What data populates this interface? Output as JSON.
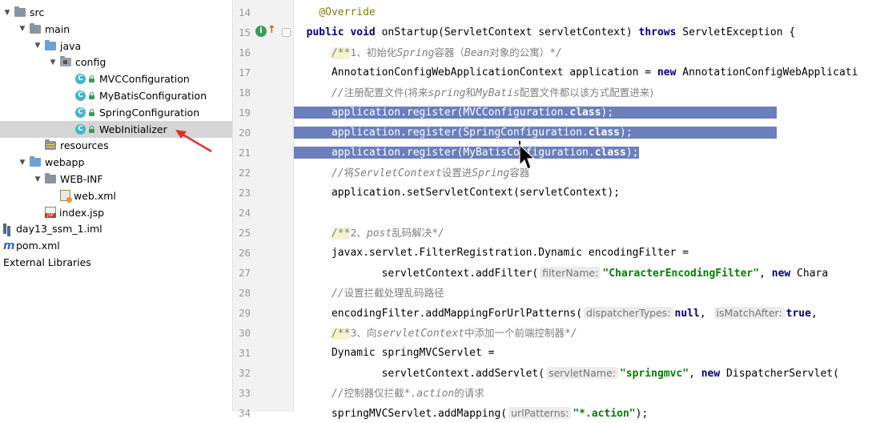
{
  "tree": {
    "items": [
      {
        "label": "src",
        "depth": 0,
        "arrow": "▼",
        "icon": "folder",
        "selected": false
      },
      {
        "label": "main",
        "depth": 1,
        "arrow": "▼",
        "icon": "folder",
        "selected": false
      },
      {
        "label": "java",
        "depth": 2,
        "arrow": "▼",
        "icon": "folder-blue",
        "selected": false
      },
      {
        "label": "config",
        "depth": 3,
        "arrow": "▼",
        "icon": "package",
        "selected": false
      },
      {
        "label": "MVCConfiguration",
        "depth": 4,
        "arrow": "",
        "icon": "class",
        "selected": false
      },
      {
        "label": "MyBatisConfiguration",
        "depth": 4,
        "arrow": "",
        "icon": "class",
        "selected": false
      },
      {
        "label": "SpringConfiguration",
        "depth": 4,
        "arrow": "",
        "icon": "class",
        "selected": false
      },
      {
        "label": "WebInitializer",
        "depth": 4,
        "arrow": "",
        "icon": "class",
        "selected": true
      },
      {
        "label": "resources",
        "depth": 2,
        "arrow": "",
        "icon": "resources",
        "selected": false
      },
      {
        "label": "webapp",
        "depth": 1,
        "arrow": "▼",
        "icon": "folder-web",
        "selected": false
      },
      {
        "label": "WEB-INF",
        "depth": 2,
        "arrow": "▼",
        "icon": "folder",
        "selected": false
      },
      {
        "label": "web.xml",
        "depth": 3,
        "arrow": "",
        "icon": "xml",
        "selected": false
      },
      {
        "label": "index.jsp",
        "depth": 2,
        "arrow": "",
        "icon": "jsp",
        "selected": false
      },
      {
        "label": "day13_ssm_1.iml",
        "depth": 0,
        "arrow": "",
        "icon": "iml",
        "selected": false
      },
      {
        "label": "pom.xml",
        "depth": 0,
        "arrow": "",
        "icon": "maven",
        "selected": false
      },
      {
        "label": "External Libraries",
        "depth": 0,
        "arrow": "",
        "icon": "none",
        "selected": false
      }
    ]
  },
  "editor": {
    "line_numbers": [
      "14",
      "15",
      "16",
      "17",
      "18",
      "19",
      "20",
      "21",
      "22",
      "23",
      "24",
      "25",
      "26",
      "27",
      "28",
      "29",
      "30",
      "31",
      "32",
      "33",
      "34"
    ],
    "lines": {
      "l14": {
        "annotation": "@Override"
      },
      "l15": {
        "kw1": "public",
        "kw2": "void",
        "mid": " onStartup(ServletContext servletContext) ",
        "kw3": "throws",
        "tail": " ServletException {"
      },
      "l16": {
        "open": "/**",
        "text": "1、初始化",
        "it1": "Spring",
        "text2": "容器（",
        "it2": "Bean",
        "text3": "对象的公寓）",
        "close": "*/"
      },
      "l17": {
        "head": "AnnotationConfigWebApplicationContext application = ",
        "kw": "new",
        "tail": " AnnotationConfigWebApplicati"
      },
      "l18": {
        "open": "//",
        "text": "注册配置文件(将来",
        "it1": "spring",
        "text2": "和",
        "it2": "MyBatis",
        "text3": "配置文件都以该方式配置进来)"
      },
      "l19": {
        "head": "application.register(MVCConfiguration.",
        "kw": "class",
        "tail": ");"
      },
      "l20": {
        "head": "application.register(SpringConfiguration.",
        "kw": "class",
        "tail": ");"
      },
      "l21": {
        "head": "application.register(MyBatisConfiguration.",
        "kw": "class",
        "tail": ");"
      },
      "l22": {
        "open": "//",
        "text": "将",
        "it1": "ServletContext",
        "text2": "设置进",
        "it2": "Spring",
        "text3": "容器"
      },
      "l23": {
        "code": "application.setServletContext(servletContext);"
      },
      "l25": {
        "open": "/**",
        "text": "2、",
        "it1": "post",
        "text2": "乱码解决",
        "close": "*/"
      },
      "l26": {
        "code": "javax.servlet.FilterRegistration.Dynamic encodingFilter ="
      },
      "l27": {
        "head": "servletContext.addFilter(",
        "hint": "filterName:",
        "str": "\"CharacterEncodingFilter\"",
        "mid": ", ",
        "kw": "new",
        "tail": " Chara"
      },
      "l28": {
        "open": "//",
        "text": "设置拦截处理乱码路径"
      },
      "l29": {
        "head": "encodingFilter.addMappingForUrlPatterns(",
        "hint1": "dispatcherTypes:",
        "kw1": "null",
        "mid": ",",
        "hint2": "isMatchAfter:",
        "kw2": "true",
        "tail": ","
      },
      "l30": {
        "open": "/**",
        "text": "3、向",
        "it1": "servletContext",
        "text2": "中添加一个前端控制器",
        "close": "*/"
      },
      "l31": {
        "code": "Dynamic springMVCServlet ="
      },
      "l32": {
        "head": "servletContext.addServlet(",
        "hint": "servletName:",
        "str": "\"springmvc\"",
        "mid": ", ",
        "kw": "new",
        "tail": " DispatcherServlet("
      },
      "l33": {
        "open": "//",
        "text": "控制器仅拦截",
        "it1": "*.action",
        "text2": "的请求"
      },
      "l34": {
        "head": "springMVCServlet.addMapping(",
        "hint": "urlPatterns:",
        "str": "\"*.action\"",
        "tail": ");"
      }
    }
  }
}
